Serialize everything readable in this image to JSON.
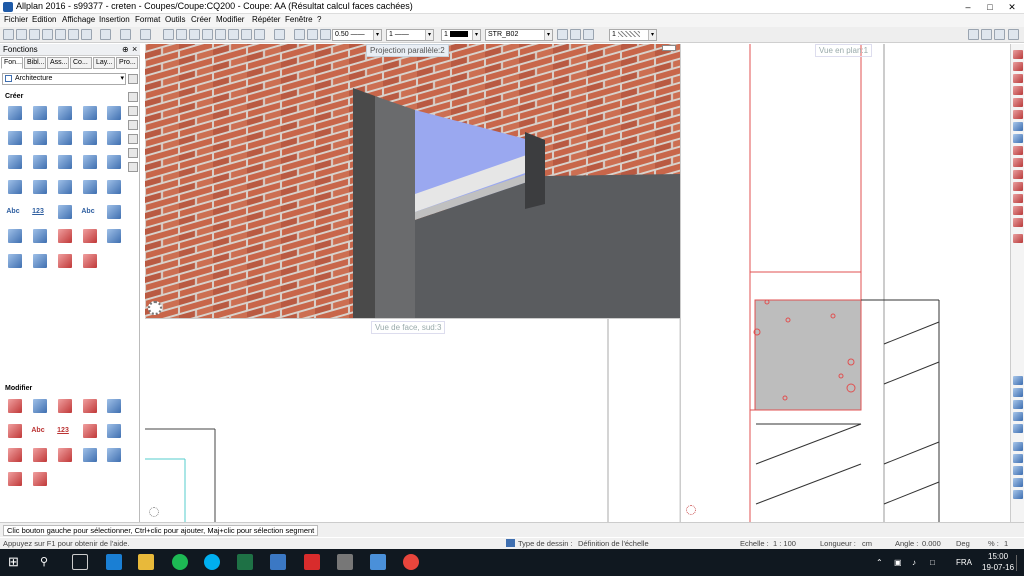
{
  "window": {
    "title": "Allplan 2016 - s99377 - creten - Coupes/Coupe:CQ200 - Coupe: AA (Résultat calcul faces cachées)"
  },
  "menu": [
    "Fichier",
    "Edition",
    "Affichage",
    "Insertion",
    "Format",
    "Outils",
    "Créer",
    "Modifier",
    "Répéter",
    "Fenêtre",
    "?"
  ],
  "toolbar": {
    "pen_thickness": "0.50",
    "line_type": "1",
    "color_number": "1",
    "layer": "STR_B02",
    "pattern": "1"
  },
  "left_panel": {
    "title": "Fonctions",
    "pin": "⊕",
    "close": "×",
    "tabs": [
      "Fon...",
      "Bibl...",
      "Ass...",
      "Co...",
      "Lay...",
      "Pro..."
    ],
    "module": "Architecture",
    "section_create": "Créer",
    "section_modify": "Modifier",
    "text_icons": {
      "abc": "Abc",
      "num": "123",
      "abc2": "Abc",
      "abc3": "Abc",
      "num2": "123"
    }
  },
  "viewports": {
    "perspective_label": "Projection parallèle:2",
    "front_label": "Vue de face, sud:3",
    "plan_label": "Vue en plan:1"
  },
  "prompt": "Clic bouton gauche pour sélectionner, Ctrl+clic pour ajouter, Maj+clic pour sélection segment",
  "status": {
    "help": "Appuyez sur F1 pour obtenir de l'aide.",
    "draw_type_label": "Type de dessin :",
    "draw_type_value": "Définition de l'échelle",
    "scale_label": "Echelle :",
    "scale_value": "1 : 100",
    "length_label": "Longueur :",
    "length_value": "cm",
    "angle_label": "Angle :",
    "angle_value": "0.000",
    "angle_unit": "Deg",
    "percent_label": "% :",
    "percent_value": "1"
  },
  "taskbar": {
    "language": "FRA",
    "time": "15:00",
    "date": "19-07-16"
  },
  "colors": {
    "brick": "#c8664a",
    "mortar": "#d8d2cc",
    "concrete": "#5a5c5f",
    "glass": "#9aa8f0",
    "section_red": "#e05050",
    "accent": "#1e5aa8"
  }
}
